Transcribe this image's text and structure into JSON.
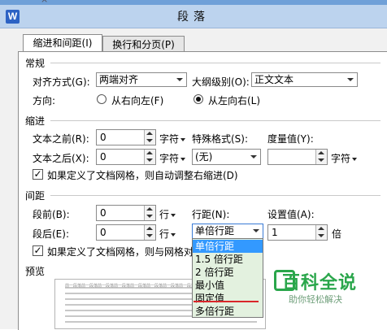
{
  "window": {
    "title": "段落",
    "app_icon": "W",
    "top_strip_fragment": "×"
  },
  "tabs": [
    {
      "label": "缩进和间距(I)",
      "active": true
    },
    {
      "label": "换行和分页(P)",
      "active": false
    }
  ],
  "general": {
    "section": "常规",
    "alignment_label": "对齐方式(G):",
    "alignment_value": "两端对齐",
    "outline_label": "大纲级别(O):",
    "outline_value": "正文文本",
    "direction_label": "方向:",
    "rtl_label": "从右向左(F)",
    "ltr_label": "从左向右(L)",
    "selected_direction": "ltr"
  },
  "indent": {
    "section": "缩进",
    "before_label": "文本之前(R):",
    "before_value": "0",
    "before_unit": "字符",
    "after_label": "文本之后(X):",
    "after_value": "0",
    "after_unit": "字符",
    "special_label": "特殊格式(S):",
    "special_value": "(无)",
    "measure_label": "度量值(Y):",
    "measure_value": "",
    "measure_unit": "字符",
    "grid_check_label": "如果定义了文档网格，则自动调整右缩进(D)",
    "grid_checked": true
  },
  "spacing": {
    "section": "间距",
    "before_label": "段前(B):",
    "before_value": "0",
    "before_unit": "行",
    "after_label": "段后(E):",
    "after_value": "0",
    "after_unit": "行",
    "line_spacing_label": "行距(N):",
    "line_spacing_value": "单倍行距",
    "setting_label": "设置值(A):",
    "setting_value": "1",
    "setting_unit": "倍",
    "grid_check_label": "如果定义了文档网格，则与网格对",
    "grid_checked": true
  },
  "line_spacing_options": [
    "单倍行距",
    "1.5 倍行距",
    "2 倍行距",
    "最小值",
    "固定值",
    "多倍行距"
  ],
  "line_spacing_selected_index": 0,
  "preview": {
    "section": "预览",
    "sample_line": "前一段落前一段落前一段落前一段落前一段落前一段落前一段落前一段落前一段落"
  },
  "watermark": {
    "main": "百科全说",
    "sub": "助你轻松解决"
  },
  "colors": {
    "selection": "#3399ff",
    "dropdown_bg": "#e3f1df",
    "red_underline": "#d9262a",
    "watermark_green": "#2aa64b"
  }
}
